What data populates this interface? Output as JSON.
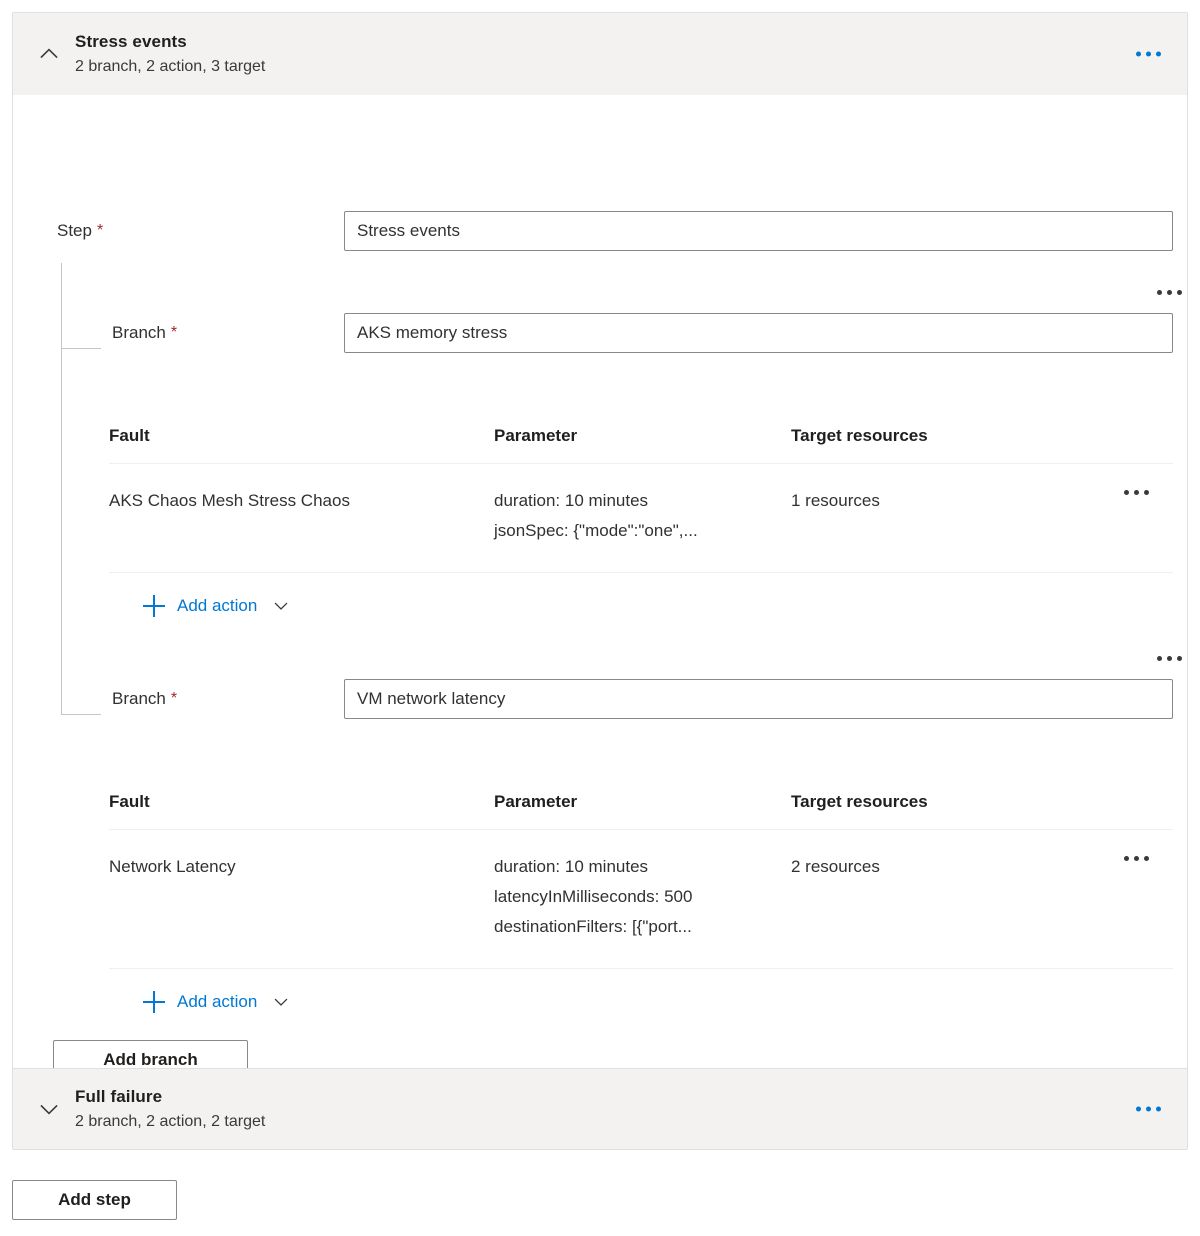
{
  "steps": [
    {
      "title": "Stress events",
      "summary": "2 branch, 2 action, 3 target",
      "expanded": true,
      "chevron_icon": "chevron-up-icon",
      "menu_icon": "more-options-icon",
      "step_field": {
        "label": "Step",
        "required_marker": "*",
        "value": "Stress events"
      },
      "branches": [
        {
          "label": "Branch",
          "required_marker": "*",
          "value": "AKS memory stress",
          "table": {
            "headers": [
              "Fault",
              "Parameter",
              "Target resources"
            ],
            "rows": [
              {
                "fault": "AKS Chaos Mesh Stress Chaos",
                "parameters": [
                  "duration: 10 minutes",
                  "jsonSpec: {\"mode\":\"one\",..."
                ],
                "target_resources": "1 resources"
              }
            ]
          },
          "add_action_label": "Add action"
        },
        {
          "label": "Branch",
          "required_marker": "*",
          "value": "VM network latency",
          "table": {
            "headers": [
              "Fault",
              "Parameter",
              "Target resources"
            ],
            "rows": [
              {
                "fault": "Network Latency",
                "parameters": [
                  "duration: 10 minutes",
                  "latencyInMilliseconds: 500",
                  "destinationFilters: [{\"port..."
                ],
                "target_resources": "2 resources"
              }
            ]
          },
          "add_action_label": "Add action"
        }
      ],
      "add_branch_label": "Add branch"
    },
    {
      "title": "Full failure",
      "summary": "2 branch, 2 action, 2 target",
      "expanded": false,
      "chevron_icon": "chevron-down-icon",
      "menu_icon": "more-options-icon"
    }
  ],
  "add_step_label": "Add step",
  "colors": {
    "accent": "#0078d4",
    "header_bg": "#f3f2f1",
    "required": "#a4262c",
    "border": "#e1dfdd",
    "input_border": "#8a8886",
    "text": "#323130"
  }
}
